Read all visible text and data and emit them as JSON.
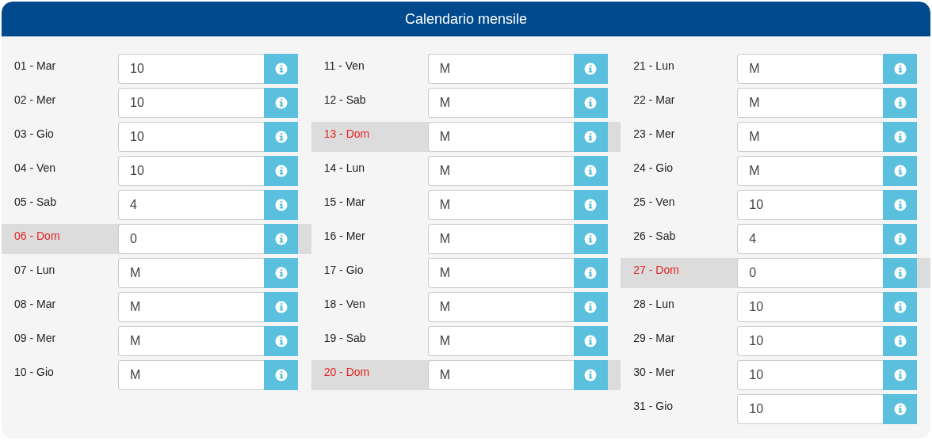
{
  "title": "Calendario mensile",
  "columns": [
    [
      {
        "label": "01 - Mar",
        "value": "10",
        "holiday": false
      },
      {
        "label": "02 - Mer",
        "value": "10",
        "holiday": false
      },
      {
        "label": "03 - Gio",
        "value": "10",
        "holiday": false
      },
      {
        "label": "04 - Ven",
        "value": "10",
        "holiday": false
      },
      {
        "label": "05 - Sab",
        "value": "4",
        "holiday": false
      },
      {
        "label": "06 - Dom",
        "value": "0",
        "holiday": true
      },
      {
        "label": "07 - Lun",
        "value": "M",
        "holiday": false
      },
      {
        "label": "08 - Mar",
        "value": "M",
        "holiday": false
      },
      {
        "label": "09 - Mer",
        "value": "M",
        "holiday": false
      },
      {
        "label": "10 - Gio",
        "value": "M",
        "holiday": false
      }
    ],
    [
      {
        "label": "11 - Ven",
        "value": "M",
        "holiday": false
      },
      {
        "label": "12 - Sab",
        "value": "M",
        "holiday": false
      },
      {
        "label": "13 - Dom",
        "value": "M",
        "holiday": true
      },
      {
        "label": "14 - Lun",
        "value": "M",
        "holiday": false
      },
      {
        "label": "15 - Mar",
        "value": "M",
        "holiday": false
      },
      {
        "label": "16 - Mer",
        "value": "M",
        "holiday": false
      },
      {
        "label": "17 - Gio",
        "value": "M",
        "holiday": false
      },
      {
        "label": "18 - Ven",
        "value": "M",
        "holiday": false
      },
      {
        "label": "19 - Sab",
        "value": "M",
        "holiday": false
      },
      {
        "label": "20 - Dom",
        "value": "M",
        "holiday": true
      }
    ],
    [
      {
        "label": "21 - Lun",
        "value": "M",
        "holiday": false
      },
      {
        "label": "22 - Mar",
        "value": "M",
        "holiday": false
      },
      {
        "label": "23 - Mer",
        "value": "M",
        "holiday": false
      },
      {
        "label": "24 - Gio",
        "value": "M",
        "holiday": false
      },
      {
        "label": "25 - Ven",
        "value": "10",
        "holiday": false
      },
      {
        "label": "26 - Sab",
        "value": "4",
        "holiday": false
      },
      {
        "label": "27 - Dom",
        "value": "0",
        "holiday": true
      },
      {
        "label": "28 - Lun",
        "value": "10",
        "holiday": false
      },
      {
        "label": "29 - Mar",
        "value": "10",
        "holiday": false
      },
      {
        "label": "30 - Mer",
        "value": "10",
        "holiday": false
      },
      {
        "label": "31 - Gio",
        "value": "10",
        "holiday": false
      }
    ]
  ]
}
